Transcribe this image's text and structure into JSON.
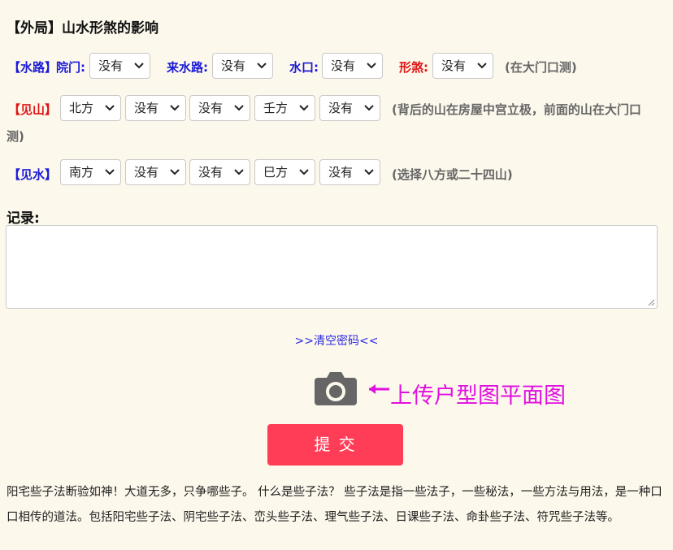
{
  "title": "【外局】山水形煞的影响",
  "row1": {
    "label": "【水路】",
    "yard_label": "院门:",
    "yard_value": "没有",
    "incoming_label": "来水路:",
    "incoming_value": "没有",
    "mouth_label": "水口:",
    "mouth_value": "没有",
    "sha_label": "形煞:",
    "sha_value": "没有",
    "note": "(在大门口测)"
  },
  "row2": {
    "label": "【见山】",
    "values": [
      "北方",
      "没有",
      "没有",
      "壬方",
      "没有"
    ],
    "note_line1": "(背后的山在房屋中宫立极，前面的山在大门口",
    "note_line2": "测)"
  },
  "row3": {
    "label": "【见水】",
    "values": [
      "南方",
      "没有",
      "没有",
      "巳方",
      "没有"
    ],
    "note": "(选择八方或二十四山)"
  },
  "record": {
    "label": "记录:",
    "value": ""
  },
  "clear_link": ">>清空密码<<",
  "upload": {
    "icon": "camera-icon",
    "arrow": "←",
    "label": "上传户型图平面图"
  },
  "submit": "提 交",
  "paragraph": "阳宅些子法断验如神！大道无多，只争哪些子。 什么是些子法？ 些子法是指一些法子，一些秘法，一些方法与用法，是一种口口相传的道法。包括阳宅些子法、阴宅些子法、峦头些子法、理气些子法、日课些子法、命卦些子法、符咒些子法等。",
  "colors": {
    "background": "#fdf8ec",
    "accent_blue": "#1a1ad6",
    "accent_red": "#e01515",
    "submit": "#ff3d57",
    "upload": "#e010e0"
  }
}
